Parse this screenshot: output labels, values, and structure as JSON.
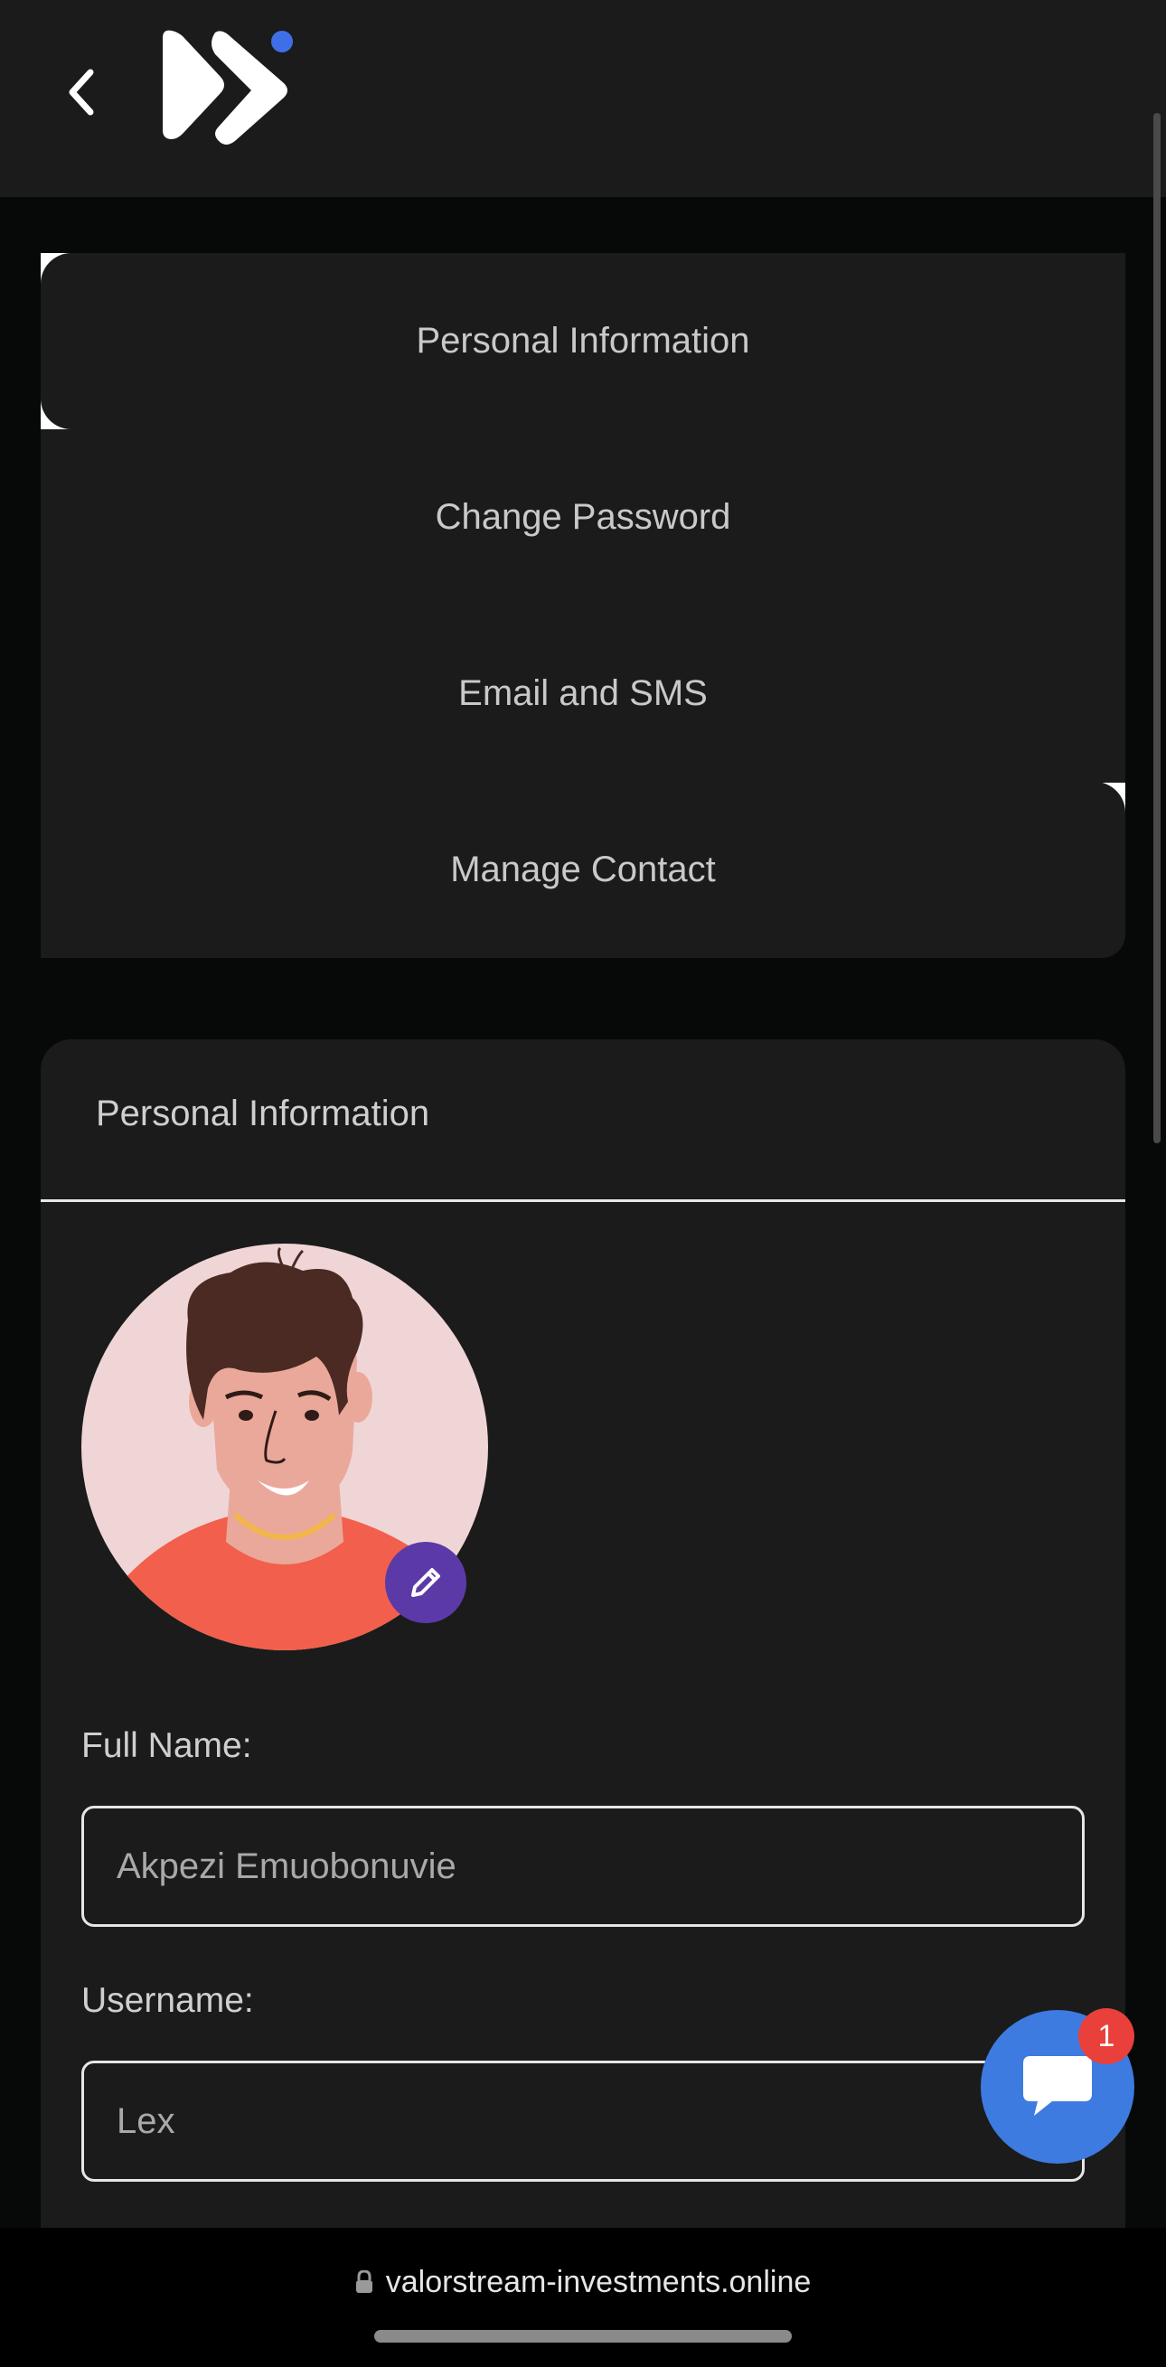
{
  "header": {
    "back_icon": "chevron-left-icon",
    "logo_icon": "double-chevron-logo-icon",
    "accent_color": "#3f6fe6"
  },
  "nav": {
    "items": [
      {
        "label": "Personal Information"
      },
      {
        "label": "Change Password"
      },
      {
        "label": "Email and SMS"
      },
      {
        "label": "Manage Contact"
      }
    ]
  },
  "info": {
    "title": "Personal Information",
    "edit_icon": "pencil-icon",
    "fields": [
      {
        "label": "Full Name:",
        "value": "Akpezi Emuobonuvie"
      },
      {
        "label": "Username:",
        "value": "Lex"
      }
    ]
  },
  "chat": {
    "icon": "chat-bubble-icon",
    "badge_count": "1",
    "color": "#3d7be0"
  },
  "browser": {
    "lock_icon": "lock-icon",
    "url": "valorstream-investments.online"
  }
}
